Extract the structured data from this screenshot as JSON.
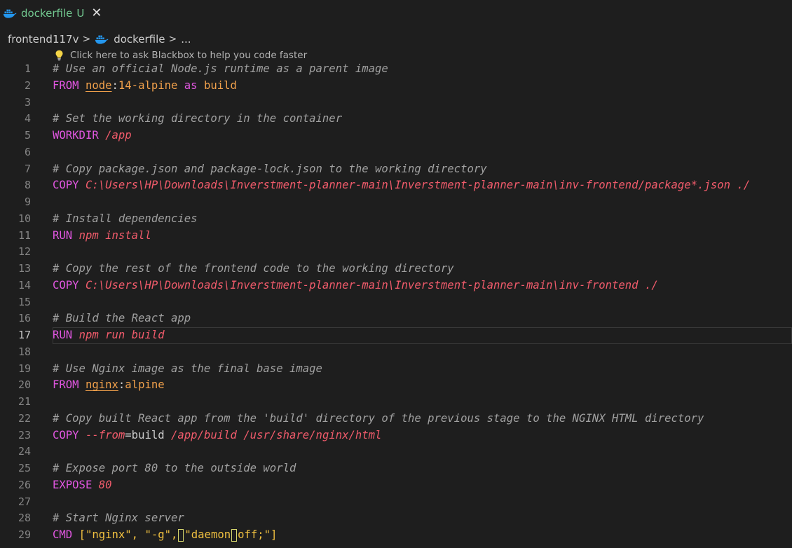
{
  "tab": {
    "name": "dockerfile",
    "status": "U",
    "close": "✕",
    "icon": "docker-icon"
  },
  "breadcrumb": {
    "folder": "frontend117v",
    "file": "dockerfile",
    "more": "...",
    "separator": ">"
  },
  "codelens": {
    "text": "Click here to ask Blackbox to help you code faster",
    "icon": "lightbulb-icon"
  },
  "editor": {
    "current_line": 17,
    "lines": [
      {
        "n": "1",
        "tokens": [
          {
            "c": "t-comment",
            "v": "# Use an official Node.js runtime as a parent image"
          }
        ]
      },
      {
        "n": "2",
        "tokens": [
          {
            "c": "t-kw",
            "v": "FROM "
          },
          {
            "c": "t-img",
            "v": "node"
          },
          {
            "c": "t-op",
            "v": ":"
          },
          {
            "c": "t-tag",
            "v": "14-alpine"
          },
          {
            "c": "t-kw",
            "v": " as "
          },
          {
            "c": "t-tag",
            "v": "build"
          }
        ]
      },
      {
        "n": "3",
        "tokens": []
      },
      {
        "n": "4",
        "tokens": [
          {
            "c": "t-comment",
            "v": "# Set the working directory in the container"
          }
        ]
      },
      {
        "n": "5",
        "tokens": [
          {
            "c": "t-kw",
            "v": "WORKDIR "
          },
          {
            "c": "t-path",
            "v": "/app"
          }
        ]
      },
      {
        "n": "6",
        "tokens": []
      },
      {
        "n": "7",
        "tokens": [
          {
            "c": "t-comment",
            "v": "# Copy package.json and package-lock.json to the working directory"
          }
        ]
      },
      {
        "n": "8",
        "tokens": [
          {
            "c": "t-kw",
            "v": "COPY "
          },
          {
            "c": "t-path",
            "v": "C:\\Users\\HP\\Downloads\\Inverstment-planner-main\\Inverstment-planner-main\\inv-frontend/package*.json ./"
          }
        ]
      },
      {
        "n": "9",
        "tokens": []
      },
      {
        "n": "10",
        "tokens": [
          {
            "c": "t-comment",
            "v": "# Install dependencies"
          }
        ]
      },
      {
        "n": "11",
        "tokens": [
          {
            "c": "t-kw",
            "v": "RUN "
          },
          {
            "c": "t-path",
            "v": "npm install"
          }
        ]
      },
      {
        "n": "12",
        "tokens": []
      },
      {
        "n": "13",
        "tokens": [
          {
            "c": "t-comment",
            "v": "# Copy the rest of the frontend code to the working directory"
          }
        ]
      },
      {
        "n": "14",
        "tokens": [
          {
            "c": "t-kw",
            "v": "COPY "
          },
          {
            "c": "t-path",
            "v": "C:\\Users\\HP\\Downloads\\Inverstment-planner-main\\Inverstment-planner-main\\inv-frontend ./"
          }
        ]
      },
      {
        "n": "15",
        "tokens": []
      },
      {
        "n": "16",
        "tokens": [
          {
            "c": "t-comment",
            "v": "# Build the React app"
          }
        ]
      },
      {
        "n": "17",
        "tokens": [
          {
            "c": "t-kw",
            "v": "RUN "
          },
          {
            "c": "t-path",
            "v": "npm run build"
          }
        ]
      },
      {
        "n": "18",
        "tokens": []
      },
      {
        "n": "19",
        "tokens": [
          {
            "c": "t-comment",
            "v": "# Use Nginx image as the final base image"
          }
        ]
      },
      {
        "n": "20",
        "tokens": [
          {
            "c": "t-kw",
            "v": "FROM "
          },
          {
            "c": "t-img",
            "v": "nginx"
          },
          {
            "c": "t-op",
            "v": ":"
          },
          {
            "c": "t-tag",
            "v": "alpine"
          }
        ]
      },
      {
        "n": "21",
        "tokens": []
      },
      {
        "n": "22",
        "tokens": [
          {
            "c": "t-comment",
            "v": "# Copy built React app from the 'build' directory of the previous stage to the NGINX HTML directory"
          }
        ]
      },
      {
        "n": "23",
        "tokens": [
          {
            "c": "t-kw",
            "v": "COPY "
          },
          {
            "c": "t-flag",
            "v": "--from"
          },
          {
            "c": "t-op",
            "v": "=build "
          },
          {
            "c": "t-path",
            "v": "/app/build /usr/share/nginx/html"
          }
        ]
      },
      {
        "n": "24",
        "tokens": []
      },
      {
        "n": "25",
        "tokens": [
          {
            "c": "t-comment",
            "v": "# Expose port 80 to the outside world"
          }
        ]
      },
      {
        "n": "26",
        "tokens": [
          {
            "c": "t-kw",
            "v": "EXPOSE "
          },
          {
            "c": "t-num",
            "v": "80"
          }
        ]
      },
      {
        "n": "27",
        "tokens": []
      },
      {
        "n": "28",
        "tokens": [
          {
            "c": "t-comment",
            "v": "# Start Nginx server"
          }
        ]
      },
      {
        "n": "29",
        "tokens": [
          {
            "c": "t-kw",
            "v": "CMD "
          },
          {
            "c": "t-str",
            "v": "[\"nginx\", \"-g\","
          },
          {
            "c": "t-mark",
            "v": ""
          },
          {
            "c": "t-str",
            "v": "\"daemon"
          },
          {
            "c": "t-mark",
            "v": ""
          },
          {
            "c": "t-str",
            "v": "off;\"]"
          }
        ]
      }
    ]
  },
  "colors": {
    "background": "#1e1e1e",
    "untracked": "#73c991",
    "keyword": "#e056e0",
    "path": "#f05b6b",
    "image": "#f0a04b",
    "string": "#f0c040",
    "comment": "#a0a0a0",
    "docker_blue": "#2496ed",
    "bulb_yellow": "#f5d547"
  }
}
